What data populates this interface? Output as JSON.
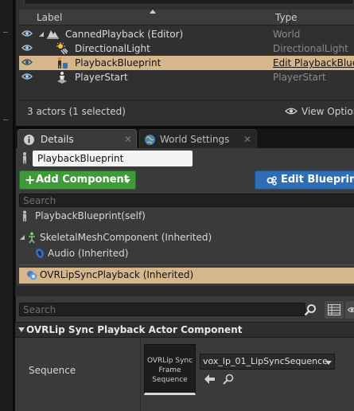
{
  "outliner": {
    "columns": {
      "label": "Label",
      "type": "Type"
    },
    "items": [
      {
        "label": "CannedPlayback (Editor)",
        "type": "World",
        "icon": "world-icon",
        "selected": false
      },
      {
        "label": "DirectionalLight",
        "type": "DirectionalLight",
        "icon": "directional-light-icon",
        "selected": false
      },
      {
        "label": "PlaybackBlueprint",
        "type": "Edit PlaybackBlue",
        "icon": "blueprint-actor-icon",
        "selected": true
      },
      {
        "label": "PlayerStart",
        "type": "PlayerStart",
        "icon": "player-start-icon",
        "selected": false
      }
    ],
    "status": "3 actors (1 selected)",
    "view_options": "View Option"
  },
  "tabs": [
    {
      "label": "Details",
      "icon": "details-icon",
      "active": true
    },
    {
      "label": "World Settings",
      "icon": "world-settings-icon",
      "active": false
    }
  ],
  "details": {
    "actor_name": "PlaybackBlueprint",
    "add_component": "Add Component",
    "edit_blueprint": "Edit Blueprint",
    "component_search_placeholder": "Search",
    "components": [
      {
        "label": "PlaybackBlueprint(self)"
      },
      {
        "label": "SkeletalMeshComponent (Inherited)"
      },
      {
        "label": "Audio (Inherited)"
      },
      {
        "label": "OVRLipSyncPlayback (Inherited)",
        "selected": true
      }
    ],
    "property_search_placeholder": "Search",
    "category": "OVRLip Sync Playback Actor Component",
    "property": {
      "name": "Sequence",
      "thumbnail_lines": [
        "OVRLip Sync",
        "Frame",
        "Sequence"
      ],
      "value": "vox_lp_01_LipSyncSequence"
    }
  },
  "colors": {
    "selection": "#d6b78b",
    "add_component": "#3f9a3a",
    "edit_blueprint": "#2f6eb5"
  }
}
